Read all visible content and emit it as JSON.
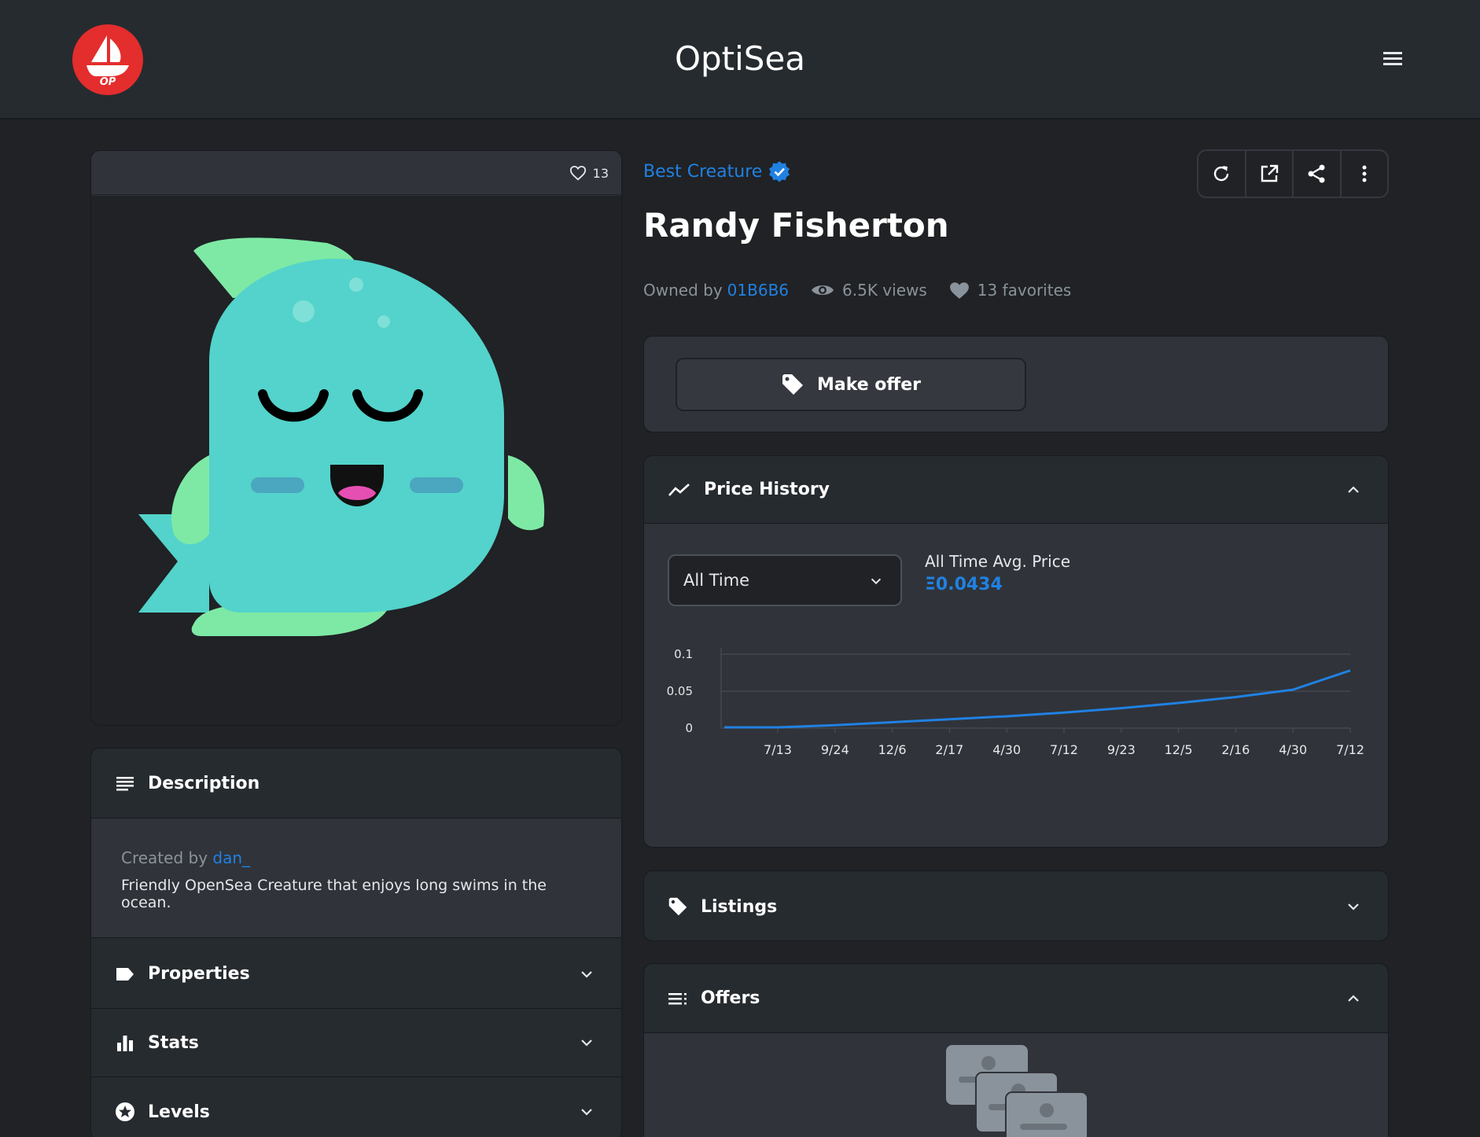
{
  "header": {
    "title": "OptiSea",
    "logo_text": "OP"
  },
  "image_card": {
    "favorites_count": "13"
  },
  "item": {
    "collection": "Best Creature",
    "name": "Randy Fisherton",
    "owned_by_label": "Owned by",
    "owner": "01B6B6",
    "views": "6.5K views",
    "favorites": "13 favorites"
  },
  "offer": {
    "make_offer_label": "Make offer"
  },
  "price_history": {
    "title": "Price History",
    "range_selected": "All Time",
    "avg_label": "All Time Avg. Price",
    "avg_value": "Ξ0.0434"
  },
  "chart_data": {
    "type": "line",
    "categories": [
      "7/13",
      "9/24",
      "12/6",
      "2/17",
      "4/30",
      "7/12",
      "9/23",
      "12/5",
      "2/16",
      "4/30",
      "7/12"
    ],
    "y_ticks": [
      "0.1",
      "0.05",
      "0"
    ],
    "ylim": [
      0,
      0.1
    ],
    "series": [
      {
        "values": [
          0.001,
          0.004,
          0.008,
          0.012,
          0.016,
          0.021,
          0.027,
          0.034,
          0.042,
          0.052,
          0.078
        ]
      }
    ],
    "grid": true,
    "color": "#2081e2"
  },
  "left_sections": {
    "description": "Description",
    "created_by_label": "Created by",
    "creator": "dan_",
    "description_text": "Friendly OpenSea Creature that enjoys long swims in the ocean.",
    "properties": "Properties",
    "stats": "Stats",
    "levels": "Levels"
  },
  "right_sections": {
    "listings": "Listings",
    "offers": "Offers"
  },
  "colors": {
    "accent": "#2081e2",
    "logo": "#e42d2d",
    "creature": "#53d3cb",
    "fin": "#7ee9a5"
  }
}
